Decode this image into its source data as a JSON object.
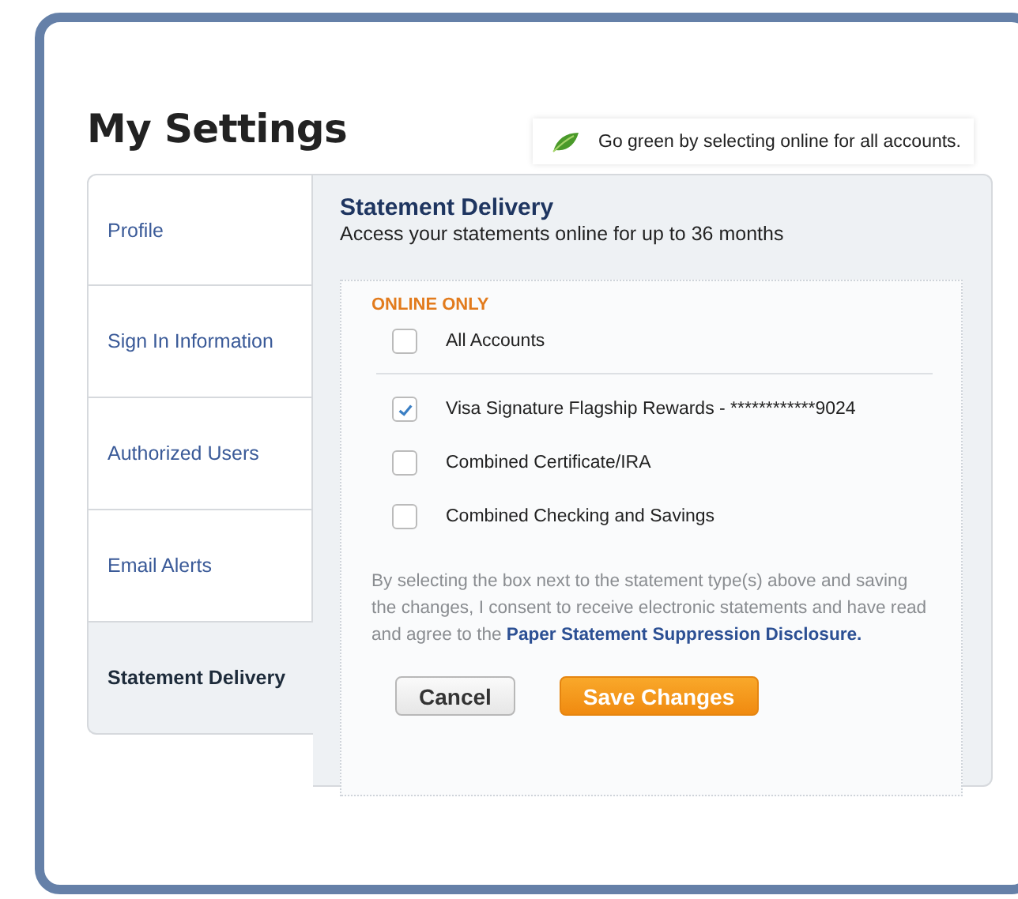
{
  "page_title": "My Settings",
  "tip": {
    "text": "Go green by selecting online for all accounts."
  },
  "sidebar": {
    "items": [
      {
        "label": "Profile",
        "selected": false
      },
      {
        "label": "Sign In Information",
        "selected": false
      },
      {
        "label": "Authorized Users",
        "selected": false
      },
      {
        "label": "Email Alerts",
        "selected": false
      },
      {
        "label": "Statement Delivery",
        "selected": true
      }
    ]
  },
  "content": {
    "title": "Statement Delivery",
    "subtitle": "Access your statements online for up to 36 months",
    "section_label": "ONLINE ONLY",
    "select_all": {
      "label": "All Accounts",
      "checked": false
    },
    "accounts": [
      {
        "label": "Visa Signature Flagship Rewards - ************9024",
        "checked": true
      },
      {
        "label": "Combined Certificate/IRA",
        "checked": false
      },
      {
        "label": "Combined Checking and Savings",
        "checked": false
      }
    ],
    "consent_text": "By selecting the box next to the statement type(s) above and saving the changes, I consent to receive electronic statements and have read and agree to the ",
    "consent_link": "Paper Statement Suppression Disclosure.",
    "buttons": [
      {
        "label": "Cancel",
        "kind": "secondary"
      },
      {
        "label": "Save Changes",
        "kind": "primary"
      }
    ]
  }
}
